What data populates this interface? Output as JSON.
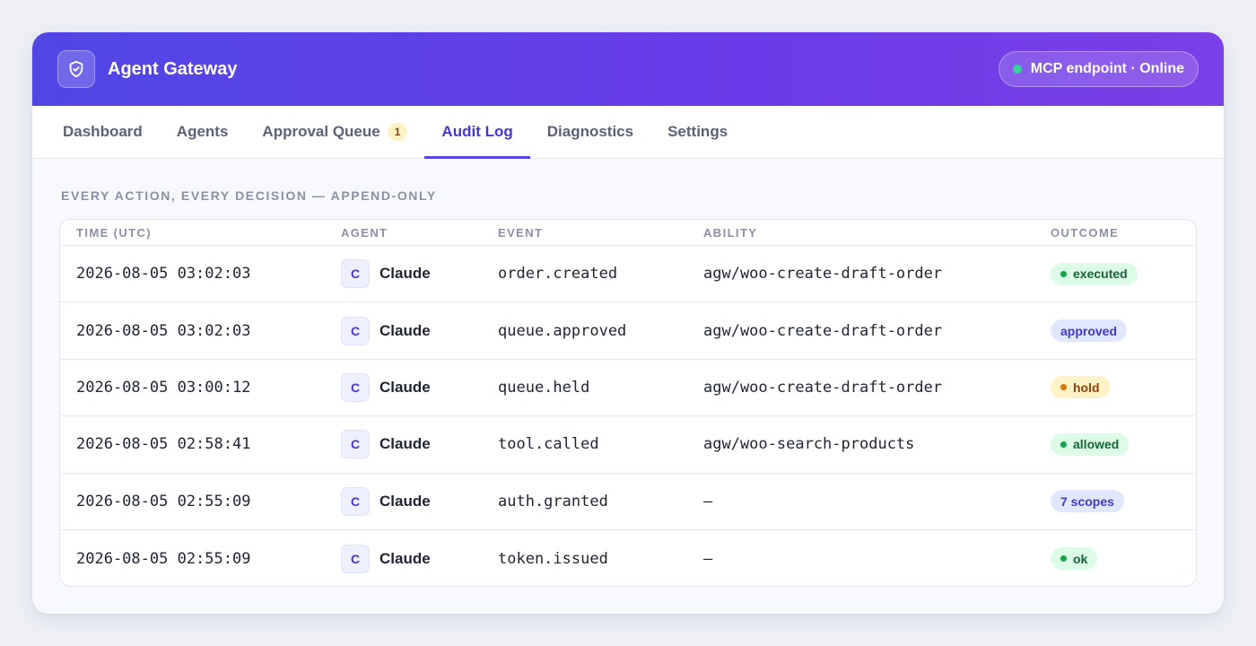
{
  "app": {
    "title": "Agent Gateway",
    "status": "MCP endpoint · Online"
  },
  "tabs": [
    {
      "label": "Dashboard",
      "active": false
    },
    {
      "label": "Agents",
      "active": false
    },
    {
      "label": "Approval Queue",
      "badge": "1",
      "active": false
    },
    {
      "label": "Audit Log",
      "active": true
    },
    {
      "label": "Diagnostics",
      "active": false
    },
    {
      "label": "Settings",
      "active": false
    }
  ],
  "section_label": "EVERY ACTION, EVERY DECISION — APPEND-ONLY",
  "table": {
    "headers": [
      "TIME (UTC)",
      "AGENT",
      "EVENT",
      "ABILITY",
      "OUTCOME"
    ],
    "rows": [
      {
        "time": "2026-08-05 03:02:03",
        "avatar": "C",
        "agent": "Claude",
        "event": "order.created",
        "ability": "agw/woo-create-draft-order",
        "outcome": "executed"
      },
      {
        "time": "2026-08-05 03:02:03",
        "avatar": "C",
        "agent": "Claude",
        "event": "queue.approved",
        "ability": "agw/woo-create-draft-order",
        "outcome": "approved"
      },
      {
        "time": "2026-08-05 03:00:12",
        "avatar": "C",
        "agent": "Claude",
        "event": "queue.held",
        "ability": "agw/woo-create-draft-order",
        "outcome": "hold"
      },
      {
        "time": "2026-08-05 02:58:41",
        "avatar": "C",
        "agent": "Claude",
        "event": "tool.called",
        "ability": "agw/woo-search-products",
        "outcome": "allowed"
      },
      {
        "time": "2026-08-05 02:55:09",
        "avatar": "C",
        "agent": "Claude",
        "event": "auth.granted",
        "ability": "—",
        "outcome": "7 scopes"
      },
      {
        "time": "2026-08-05 02:55:09",
        "avatar": "C",
        "agent": "Claude",
        "event": "token.issued",
        "ability": "—",
        "outcome": "ok"
      }
    ]
  },
  "colors": {
    "accent": "#4f46e5",
    "success_bg": "#dcfce7",
    "success_fg": "#166534",
    "success_dot": "#16a34a",
    "info_bg": "#e0e7ff",
    "info_fg": "#4338ca",
    "warn_bg": "#fef3c7",
    "warn_fg": "#92400e",
    "warn_dot": "#d97706"
  }
}
